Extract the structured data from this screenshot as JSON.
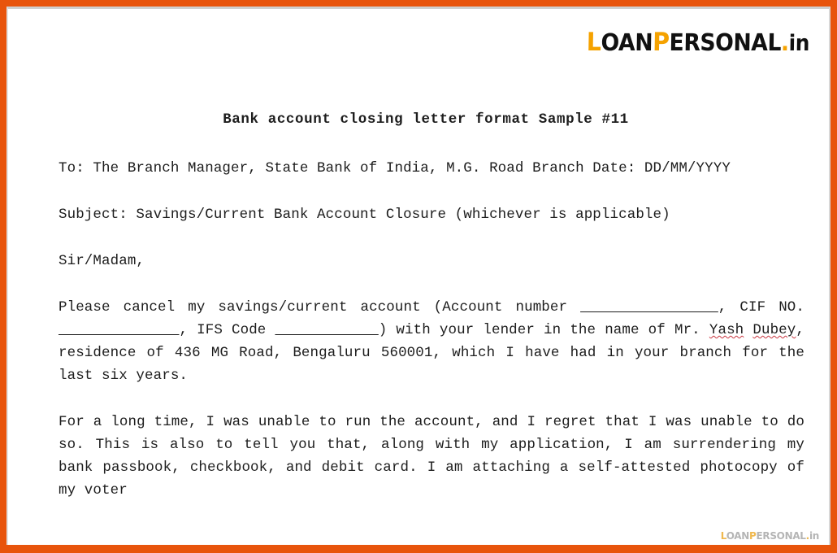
{
  "frame": {
    "border_color": "#E8540C",
    "page_background": "#FFFFFF"
  },
  "brand": {
    "accent_color": "#F5A200",
    "text_color": "#111111",
    "part1": "L",
    "part2": "OAN",
    "part3": "P",
    "part4": "ERSONAL",
    "dot": ".",
    "tld": "in",
    "full_text": "LOANPERSONAL.in"
  },
  "document": {
    "title": "Bank account closing letter format Sample #11",
    "paragraphs": {
      "addressee": "To: The Branch Manager, State Bank of India, M.G. Road Branch Date: DD/MM/YYYY",
      "subject": "Subject: Savings/Current Bank Account Closure (whichever is applicable)",
      "salutation": "Sir/Madam,",
      "body1_a": "Please cancel my savings/current account (Account number",
      "body1_blank1": "________________",
      "body1_b": ", CIF NO.",
      "body1_blank2": "______________",
      "body1_c": ", IFS Code",
      "body1_blank3": "____________",
      "body1_d": ") with your lender in the name of Mr.",
      "body1_name_first": "Yash",
      "body1_name_last": "Dubey",
      "body1_e": ", residence of 436 MG Road, Bengaluru 560001, which I have had in your branch for the last six years.",
      "body2": "For a long time, I was unable to run the account, and I regret that I was unable to do so. This is also to tell you that, along with my application, I am surrendering my bank passbook, checkbook, and debit card. I am attaching a self-attested photocopy of my voter"
    },
    "spellcheck_color": "#C9353F"
  },
  "watermark": {
    "text": "LOANPERSONAL.in"
  }
}
